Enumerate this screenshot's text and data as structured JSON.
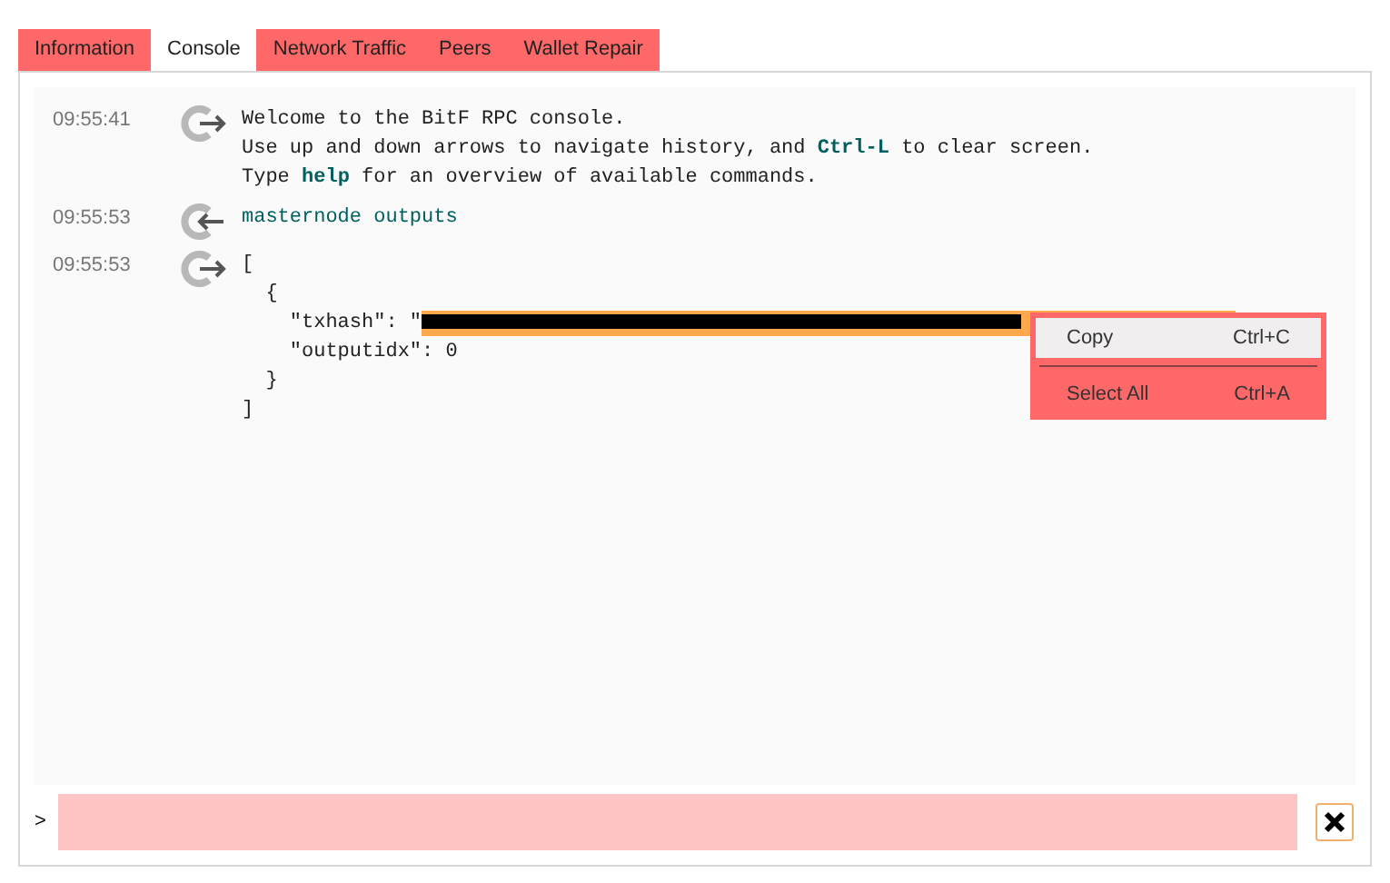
{
  "tabs": [
    {
      "label": "Information",
      "selected": false
    },
    {
      "label": "Console",
      "selected": true
    },
    {
      "label": "Network Traffic",
      "selected": false
    },
    {
      "label": "Peers",
      "selected": false
    },
    {
      "label": "Wallet Repair",
      "selected": false
    }
  ],
  "messages": [
    {
      "time": "09:55:41",
      "kind": "reply",
      "lines": [
        "Welcome to the BitF RPC console.",
        "Use up and down arrows to navigate history, and **Ctrl-L** to clear screen.",
        "Type **help** for an overview of available commands."
      ]
    },
    {
      "time": "09:55:53",
      "kind": "request",
      "lines": [
        "masternode outputs"
      ]
    },
    {
      "time": "09:55:53",
      "kind": "reply",
      "lines": [
        "[",
        "  {",
        "    \"txhash\": \"",
        "    \"outputidx\": 0",
        "  }",
        "]"
      ]
    }
  ],
  "context_menu": [
    {
      "label": "Copy",
      "shortcut": "Ctrl+C",
      "selected": true
    },
    {
      "label": "Select All",
      "shortcut": "Ctrl+A",
      "selected": false
    }
  ],
  "prompt": ">"
}
